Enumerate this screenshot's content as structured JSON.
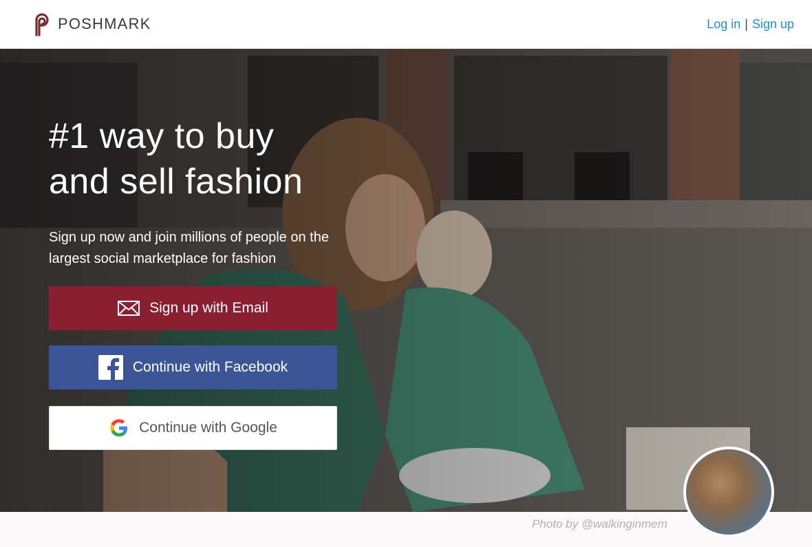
{
  "header": {
    "brand": "POSHMARK",
    "login_label": "Log in",
    "separator": "|",
    "signup_label": "Sign up"
  },
  "hero": {
    "headline_line1": "#1 way to buy",
    "headline_line2": "and sell fashion",
    "subline": "Sign up now and join millions of people on the largest social marketplace for fashion",
    "buttons": {
      "email": "Sign up with Email",
      "facebook": "Continue with Facebook",
      "google": "Continue with Google"
    }
  },
  "footer": {
    "photo_credit": "Photo by @walkinginmem"
  },
  "colors": {
    "brand": "#7a2c31",
    "email_button": "#8a1f32",
    "facebook_button": "#3b5597",
    "google_button": "#ffffff",
    "link": "#1f8fd6"
  },
  "icons": {
    "logo": "poshmark-logo-icon",
    "email": "envelope-icon",
    "facebook": "facebook-icon",
    "google": "google-icon"
  }
}
